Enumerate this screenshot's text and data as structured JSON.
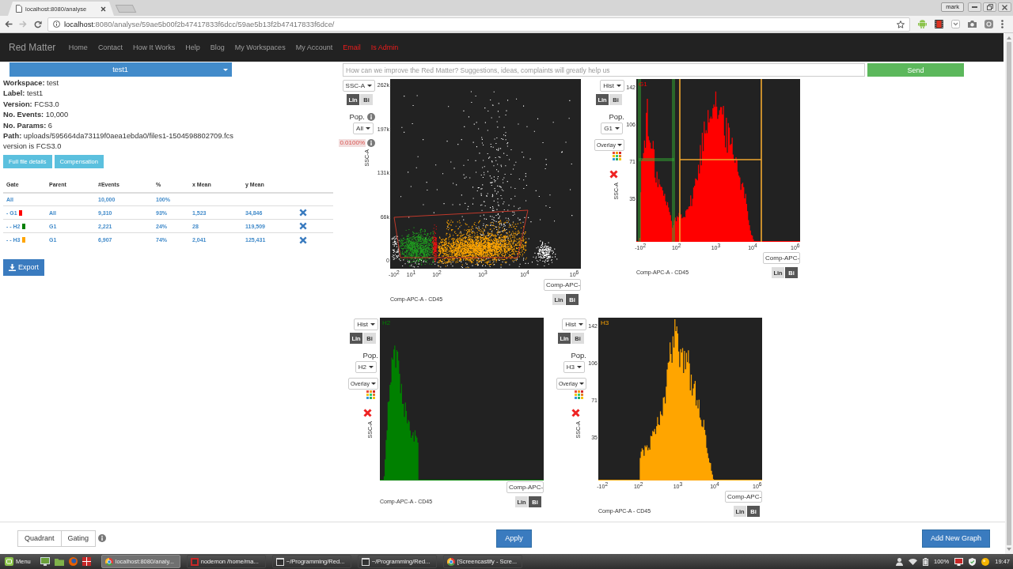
{
  "browser": {
    "tab_title": "localhost:8080/analyse",
    "profile": "mark",
    "url_host": "localhost",
    "url_rest": ":8080/analyse/59ae5b00f2b47417833f6dcc/59ae5b13f2b47417833f6dce/"
  },
  "navbar": {
    "brand": "Red Matter",
    "items": [
      {
        "label": "Home",
        "kind": "link"
      },
      {
        "label": "Contact",
        "kind": "link"
      },
      {
        "label": "How It Works",
        "kind": "link"
      },
      {
        "label": "Help",
        "kind": "link"
      },
      {
        "label": "Blog",
        "kind": "link"
      },
      {
        "label": "My Workspaces",
        "kind": "link"
      },
      {
        "label": "My Account",
        "kind": "link"
      },
      {
        "label": "Email",
        "kind": "alert"
      },
      {
        "label": "Is Admin",
        "kind": "alert"
      }
    ]
  },
  "file_selector": {
    "value": "test1"
  },
  "file_info": [
    "**Workspace:** test",
    "**Label:** test1",
    "**Version:** FCS3.0",
    "**No. Events:** 10,000",
    "**No. Params:** 6",
    "**Path:** uploads/595664da73119f0aea1ebda0/files1-1504598802709.fcs",
    "version is FCS3.0"
  ],
  "file_buttons": [
    "Full file details",
    "Compensation"
  ],
  "gate_table": {
    "columns": [
      "Gate",
      "Parent",
      "#Events",
      "%",
      "x Mean",
      "y Mean"
    ],
    "rows": [
      {
        "gate": "All",
        "events": "10,000",
        "percent": "100%",
        "deletable": false
      },
      {
        "gate": "- G1",
        "color": "#ff0000",
        "parent": "All",
        "events": "9,310",
        "percent": "93%",
        "x_mean": "1,523",
        "y_mean": "34,846",
        "deletable": true
      },
      {
        "gate": "- - H2",
        "color": "#008000",
        "parent": "G1",
        "events": "2,221",
        "percent": "24%",
        "x_mean": "28",
        "y_mean": "119,509",
        "deletable": true
      },
      {
        "gate": "- - H3",
        "color": "#ffa500",
        "parent": "G1",
        "events": "6,907",
        "percent": "74%",
        "x_mean": "2,041",
        "y_mean": "125,431",
        "deletable": true
      }
    ]
  },
  "export_button": "Export",
  "feedback": {
    "placeholder": "How can we improve the Red Matter? Suggestions, ideas, complaints will greatly help us",
    "button": "Send"
  },
  "plots": [
    {
      "kind": "scatter",
      "y_param": "SSC-A",
      "y_scale": [
        {
          "label": "Lin",
          "selected": true
        },
        {
          "label": "Bi",
          "selected": false
        }
      ],
      "pop_label": "Pop.",
      "population": "All",
      "percentage": "0.0100%",
      "y_axis_label": "SSC-A",
      "y_ticks": [
        "262k",
        "197k",
        "131k",
        "66k",
        "0"
      ],
      "x_ticks": [
        "-10$^{2}$",
        "10$^{1}$",
        "10$^{2}$",
        "10$^{3}$",
        "10$^{4}$",
        "10$^{6}$"
      ],
      "x_param": "Comp-APC-",
      "x_scale": [
        {
          "label": "Lin",
          "selected": false
        },
        {
          "label": "Bi",
          "selected": true
        }
      ],
      "x_axis_label": "Comp-APC-A - CD45"
    },
    {
      "kind": "histogram",
      "title": "G1",
      "color": "#ff0000",
      "y_param": "Hist",
      "y_scale": [
        {
          "label": "Lin",
          "selected": true
        },
        {
          "label": "Bi",
          "selected": false
        }
      ],
      "pop_label": "Pop.",
      "population": "G1",
      "overlay": "Overlay",
      "y_axis_label": "SSC-A",
      "y_ticks": [
        "142",
        "106",
        "71",
        "35"
      ],
      "x_ticks": [
        "-10$^{2}$",
        "10$^{2}$",
        "10$^{3}$",
        "10$^{4}$",
        "10$^{6}$"
      ],
      "x_param": "Comp-APC-",
      "x_scale": [
        {
          "label": "Lin",
          "selected": false
        },
        {
          "label": "Bi",
          "selected": true
        }
      ],
      "x_axis_label": "Comp-APC-A - CD45"
    },
    {
      "kind": "histogram",
      "title": "H2",
      "color": "#008000",
      "y_param": "Hist",
      "y_scale": [
        {
          "label": "Lin",
          "selected": true
        },
        {
          "label": "Bi",
          "selected": false
        }
      ],
      "pop_label": "Pop.",
      "population": "H2",
      "overlay": "Overlay",
      "y_axis_label": "SSC-A",
      "x_param": "Comp-APC-",
      "x_scale": [
        {
          "label": "Lin",
          "selected": false
        },
        {
          "label": "Bi",
          "selected": true
        }
      ],
      "x_axis_label": "Comp-APC-A - CD45"
    },
    {
      "kind": "histogram",
      "title": "H3",
      "color": "#ffa500",
      "y_param": "Hist",
      "y_scale": [
        {
          "label": "Lin",
          "selected": true
        },
        {
          "label": "Bi",
          "selected": false
        }
      ],
      "pop_label": "Pop.",
      "population": "H3",
      "overlay": "Overlay",
      "y_axis_label": "SSC-A",
      "y_ticks": [
        "142",
        "106",
        "71",
        "35"
      ],
      "x_ticks": [
        "-10$^{2}$",
        "10$^{2}$",
        "10$^{3}$",
        "10$^{4}$",
        "10$^{6}$"
      ],
      "x_param": "Comp-APC-",
      "x_scale": [
        {
          "label": "Lin",
          "selected": false
        },
        {
          "label": "Bi",
          "selected": true
        }
      ],
      "x_axis_label": "Comp-APC-A - CD45"
    }
  ],
  "bottom_bar": {
    "modes": [
      "Quadrant",
      "Gating"
    ],
    "apply": "Apply",
    "add_graph": "Add New Graph"
  },
  "taskbar": {
    "menu": "Menu",
    "windows": [
      {
        "label": "localhost:8080/analy...",
        "kind": "browser",
        "selected": true
      },
      {
        "label": "nodemon /home/ma...",
        "kind": "console",
        "selected": false
      },
      {
        "label": "~/Programming/Red...",
        "kind": "terminal",
        "selected": false
      },
      {
        "label": "~/Programming/Red...",
        "kind": "terminal",
        "selected": false
      },
      {
        "label": "[Screencastify - Scre...",
        "kind": "browser",
        "selected": false
      }
    ],
    "battery": "100%",
    "clock": "19:47"
  }
}
